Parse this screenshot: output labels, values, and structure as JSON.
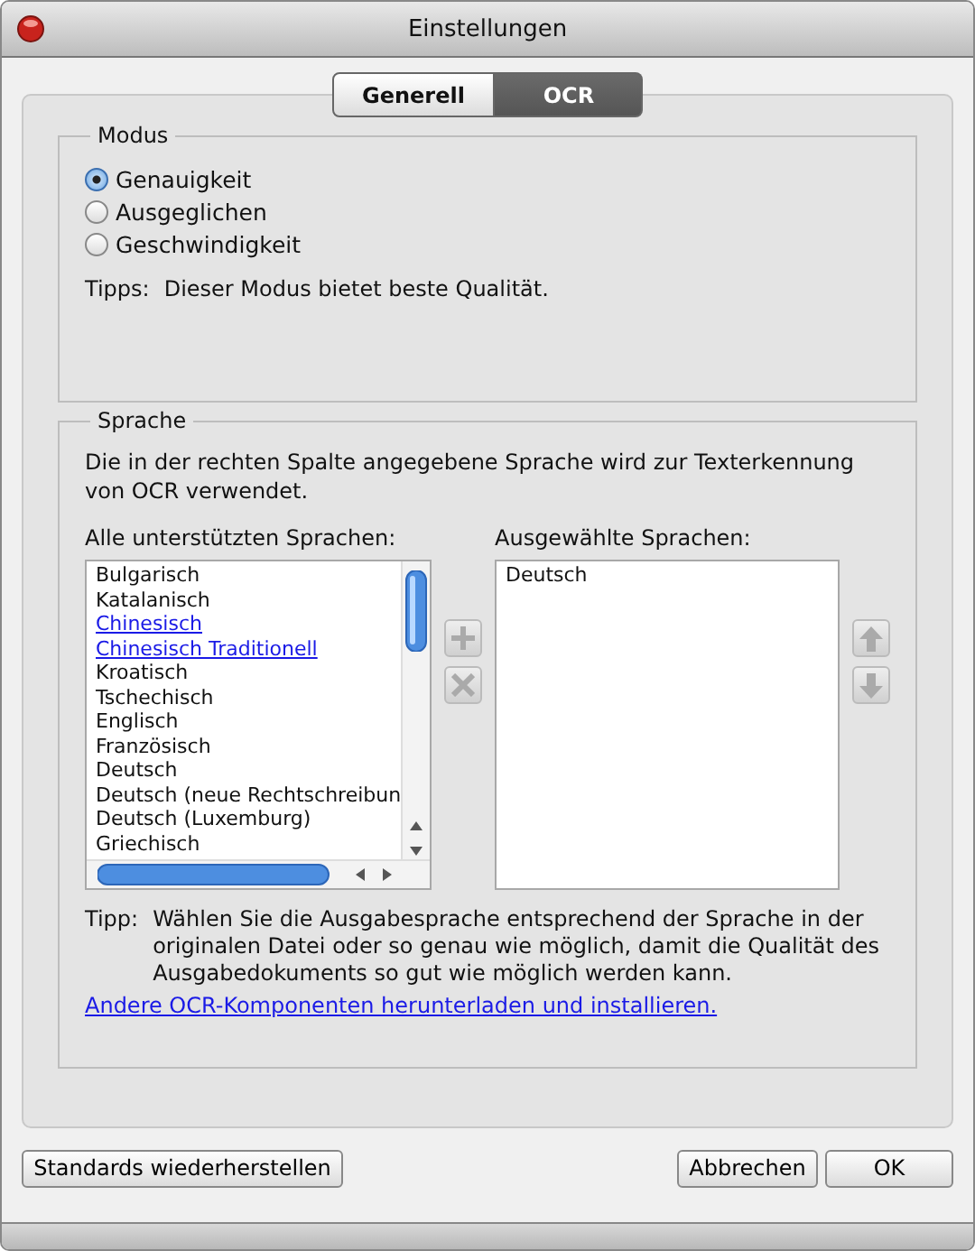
{
  "window": {
    "title": "Einstellungen"
  },
  "tabs": [
    {
      "label": "Generell",
      "selected": false
    },
    {
      "label": "OCR",
      "selected": true
    }
  ],
  "modus": {
    "title": "Modus",
    "options": [
      {
        "label": "Genauigkeit",
        "selected": true
      },
      {
        "label": "Ausgeglichen",
        "selected": false
      },
      {
        "label": "Geschwindigkeit",
        "selected": false
      }
    ],
    "tip_label": "Tipps:",
    "tip": "Dieser Modus bietet beste Qualität."
  },
  "sprache": {
    "title": "Sprache",
    "description": "Die in der rechten Spalte angegebene Sprache wird zur Texterkennung von OCR verwendet.",
    "all_label": "Alle unterstützten Sprachen:",
    "all_languages": [
      {
        "label": "Bulgarisch",
        "kind": "plain"
      },
      {
        "label": "Katalanisch",
        "kind": "plain"
      },
      {
        "label": "Chinesisch",
        "kind": "link"
      },
      {
        "label": "Chinesisch Traditionell",
        "kind": "link"
      },
      {
        "label": "Kroatisch",
        "kind": "plain"
      },
      {
        "label": "Tschechisch",
        "kind": "plain"
      },
      {
        "label": "Englisch",
        "kind": "plain"
      },
      {
        "label": "Französisch",
        "kind": "plain"
      },
      {
        "label": "Deutsch",
        "kind": "plain"
      },
      {
        "label": "Deutsch (neue Rechtschreibun",
        "kind": "plain"
      },
      {
        "label": "Deutsch (Luxemburg)",
        "kind": "plain"
      },
      {
        "label": "Griechisch",
        "kind": "plain"
      }
    ],
    "selected_label": "Ausgewählte Sprachen:",
    "selected_languages": [
      "Deutsch"
    ],
    "tip_label": "Tipp:",
    "tip": "Wählen Sie die Ausgabesprache entsprechend der Sprache in der originalen Datei oder so genau wie möglich, damit die Qualität des Ausgabedokuments so gut wie möglich werden kann.",
    "link": "Andere OCR-Komponenten herunterladen und installieren."
  },
  "buttons": {
    "reset": "Standards wiederherstellen",
    "cancel": "Abbrechen",
    "ok": "OK"
  }
}
